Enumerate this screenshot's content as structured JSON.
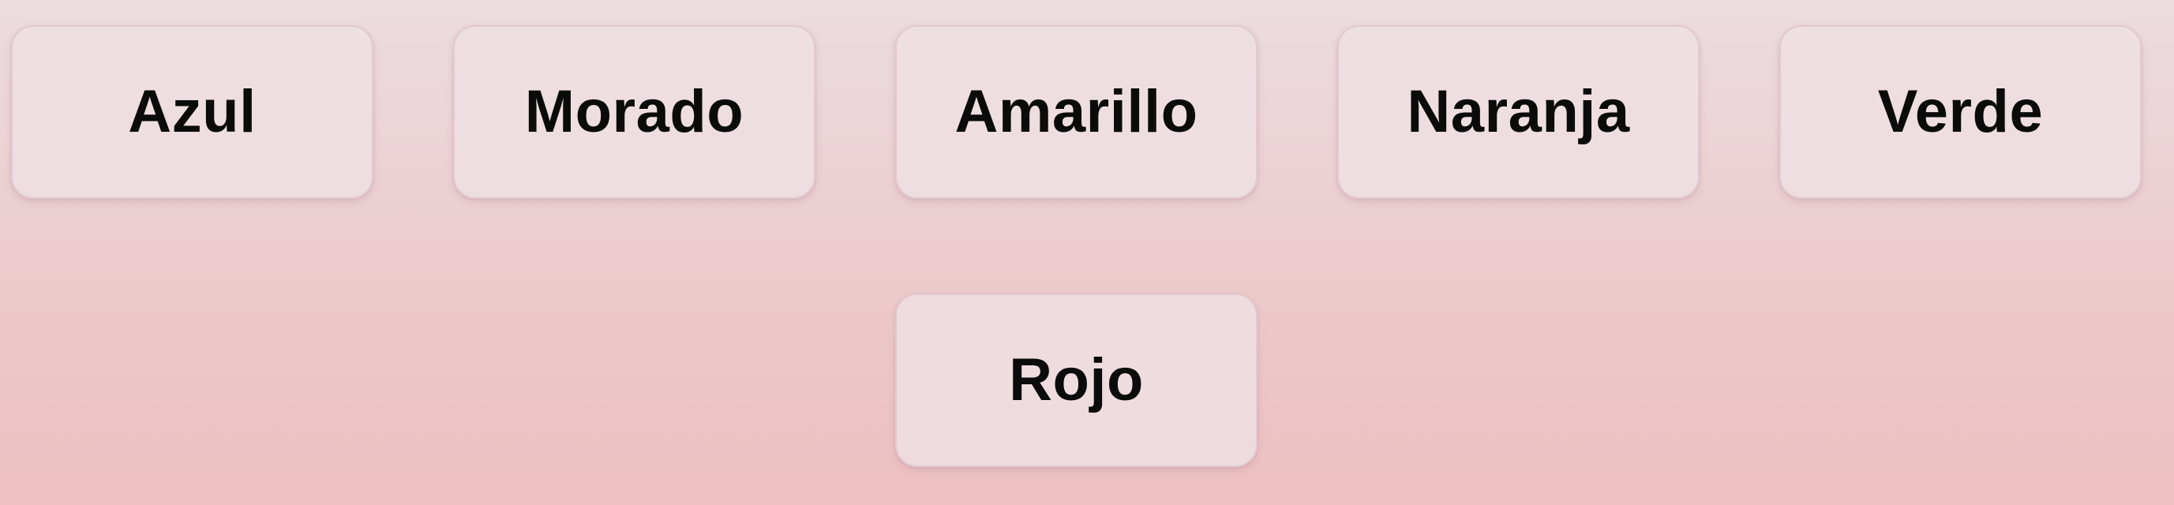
{
  "colors": {
    "background_top": "#ecdce0",
    "background_bottom": "#edc0c1",
    "button_bg": "#eedfe3",
    "text": "#0b0b0b"
  },
  "buttons": [
    {
      "label": "Azul"
    },
    {
      "label": "Morado"
    },
    {
      "label": "Amarillo"
    },
    {
      "label": "Naranja"
    },
    {
      "label": "Verde"
    },
    {
      "label": "Rojo"
    }
  ]
}
